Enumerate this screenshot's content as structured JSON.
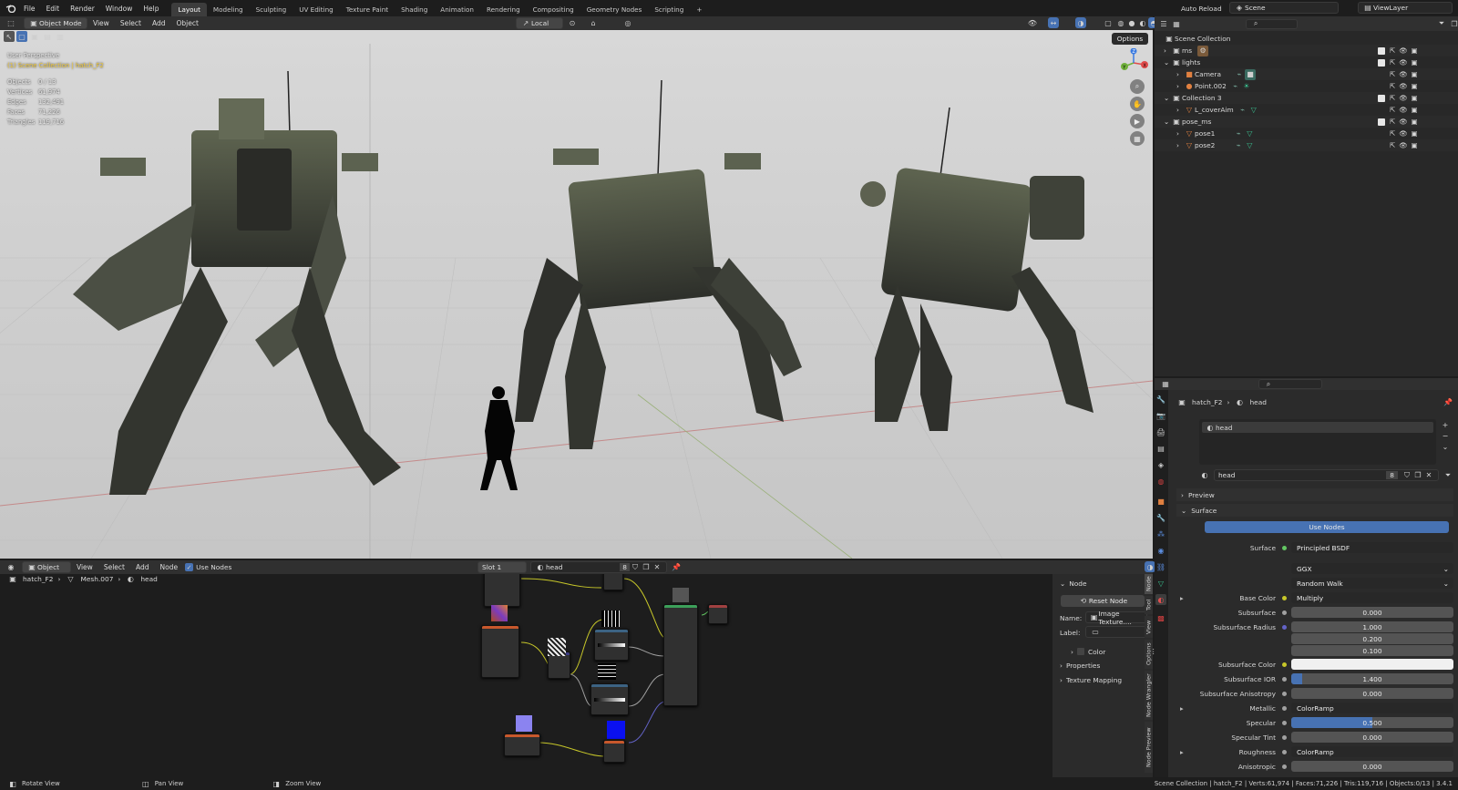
{
  "topbar": {
    "menus": [
      "File",
      "Edit",
      "Render",
      "Window",
      "Help"
    ],
    "workspaces": [
      "Layout",
      "Modeling",
      "Sculpting",
      "UV Editing",
      "Texture Paint",
      "Shading",
      "Animation",
      "Rendering",
      "Compositing",
      "Geometry Nodes",
      "Scripting"
    ],
    "active_workspace": "Layout",
    "add_tab": "+",
    "auto_reload": "Auto Reload",
    "scene": "Scene",
    "view_layer": "ViewLayer"
  },
  "viewport": {
    "mode": "Object Mode",
    "menus": [
      "View",
      "Select",
      "Add",
      "Object"
    ],
    "orientation": "Local",
    "options": "Options",
    "title": "User Perspective",
    "collection": "(1) Scene Collection | hatch_F2",
    "stats": [
      {
        "label": "Objects",
        "value": "0 / 13"
      },
      {
        "label": "Vertices",
        "value": "61,974"
      },
      {
        "label": "Edges",
        "value": "132,491"
      },
      {
        "label": "Faces",
        "value": "71,226"
      },
      {
        "label": "Triangles",
        "value": "119,716"
      }
    ],
    "gizmo": {
      "x": "X",
      "y": "Y",
      "z": "Z"
    }
  },
  "node_editor": {
    "type": "Object",
    "menus": [
      "View",
      "Select",
      "Add",
      "Node"
    ],
    "use_nodes": "Use Nodes",
    "slot": "Slot 1",
    "material": "head",
    "users": "8",
    "breadcrumb": [
      "hatch_F2",
      "Mesh.007",
      "head"
    ]
  },
  "n_panel": {
    "section": "Node",
    "reset": "Reset Node",
    "name_label": "Name:",
    "name_value": "Image Texture....",
    "label_label": "Label:",
    "label_value": "",
    "color": "Color",
    "properties": "Properties",
    "texture_mapping": "Texture Mapping",
    "tabs": [
      "Node",
      "Tool",
      "View",
      "Options",
      "Node Wrangler",
      "Node Preview"
    ]
  },
  "outliner": {
    "root": "Scene Collection",
    "items": [
      {
        "name": "ms",
        "depth": 1,
        "icon": "collection"
      },
      {
        "name": "lights",
        "depth": 1,
        "icon": "collection"
      },
      {
        "name": "Camera",
        "depth": 2,
        "icon": "camera"
      },
      {
        "name": "Point.002",
        "depth": 2,
        "icon": "light"
      },
      {
        "name": "Collection 3",
        "depth": 1,
        "icon": "collection"
      },
      {
        "name": "L_coverAim",
        "depth": 2,
        "icon": "mesh"
      },
      {
        "name": "pose_ms",
        "depth": 1,
        "icon": "collection"
      },
      {
        "name": "pose1",
        "depth": 2,
        "icon": "mesh"
      },
      {
        "name": "pose2",
        "depth": 2,
        "icon": "mesh"
      }
    ]
  },
  "properties": {
    "breadcrumb": [
      "hatch_F2",
      "head"
    ],
    "slot_name": "head",
    "material": "head",
    "users": "8",
    "preview": "Preview",
    "surface_section": "Surface",
    "use_nodes": "Use Nodes",
    "rows": [
      {
        "label": "Surface",
        "value": "Principled BSDF",
        "kind": "link",
        "dot": "#63c763"
      },
      {
        "label": "",
        "value": "GGX",
        "kind": "select"
      },
      {
        "label": "",
        "value": "Random Walk",
        "kind": "select"
      },
      {
        "label": "Base Color",
        "value": "Multiply",
        "kind": "link",
        "dot": "#c7c729",
        "arrow": true
      },
      {
        "label": "Subsurface",
        "value": "0.000",
        "kind": "num",
        "dot": "#a1a1a1"
      },
      {
        "label": "Subsurface Radius",
        "value": "1.000",
        "kind": "num",
        "dot": "#6363c7"
      },
      {
        "label": "",
        "value": "0.200",
        "kind": "num"
      },
      {
        "label": "",
        "value": "0.100",
        "kind": "num"
      },
      {
        "label": "Subsurface Color",
        "value": "",
        "kind": "color",
        "dot": "#c7c729"
      },
      {
        "label": "Subsurface IOR",
        "value": "1.400",
        "kind": "slider",
        "fill": 0.07,
        "dot": "#a1a1a1"
      },
      {
        "label": "Subsurface Anisotropy",
        "value": "0.000",
        "kind": "num",
        "dot": "#a1a1a1"
      },
      {
        "label": "Metallic",
        "value": "ColorRamp",
        "kind": "link",
        "dot": "#a1a1a1",
        "arrow": true
      },
      {
        "label": "Specular",
        "value": "0.500",
        "kind": "slider",
        "fill": 0.5,
        "dot": "#a1a1a1"
      },
      {
        "label": "Specular Tint",
        "value": "0.000",
        "kind": "num",
        "dot": "#a1a1a1"
      },
      {
        "label": "Roughness",
        "value": "ColorRamp",
        "kind": "link",
        "dot": "#a1a1a1",
        "arrow": true
      },
      {
        "label": "Anisotropic",
        "value": "0.000",
        "kind": "num",
        "dot": "#a1a1a1"
      }
    ]
  },
  "statusbar": {
    "rotate": "Rotate View",
    "pan": "Pan View",
    "zoom": "Zoom View",
    "stats": "Scene Collection | hatch_F2 | Verts:61,974 | Faces:71,226 | Tris:119,716 | Objects:0/13 | 3.4.1"
  },
  "colors": {
    "accent": "#4772b3",
    "active_ws": "#3d3d3d",
    "header": "#303030",
    "viewport_bg": "#cfcfcf"
  }
}
